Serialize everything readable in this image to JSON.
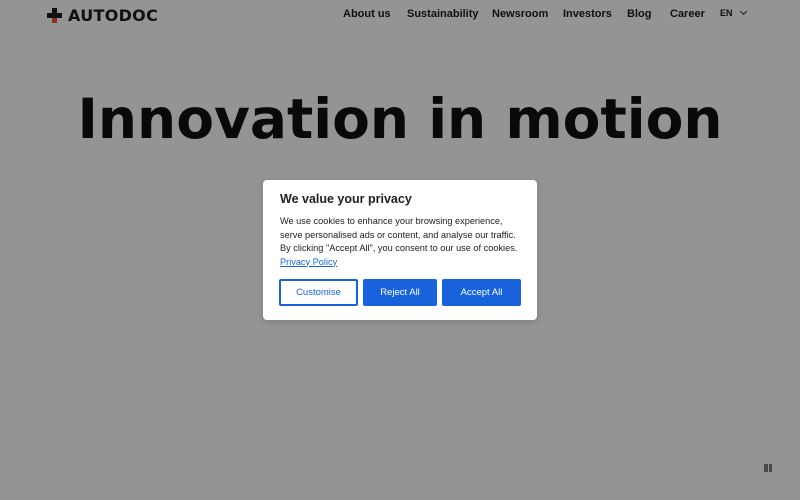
{
  "header": {
    "logo_text": "AUTODOC",
    "nav": [
      "About us",
      "Sustainability",
      "Newsroom",
      "Investors",
      "Blog",
      "Career"
    ],
    "language": "EN"
  },
  "hero": {
    "title": "Innovation in motion"
  },
  "cookie_dialog": {
    "title": "We value your privacy",
    "body": "We use cookies to enhance your browsing experience, serve personalised ads or content, and analyse our traffic. By clicking \"Accept All\", you consent to our use of cookies.",
    "privacy_link": "Privacy Policy",
    "buttons": {
      "customise": "Customise",
      "reject": "Reject All",
      "accept": "Accept All"
    }
  },
  "colors": {
    "brand_dark": "#1c1c1c",
    "brand_accent": "#f05a22",
    "button_primary": "#1863dc"
  },
  "icons": {
    "logo": "autodoc-plus-logo-icon",
    "language_dropdown": "chevron-down-icon",
    "corner_widget": "pause-icon"
  }
}
